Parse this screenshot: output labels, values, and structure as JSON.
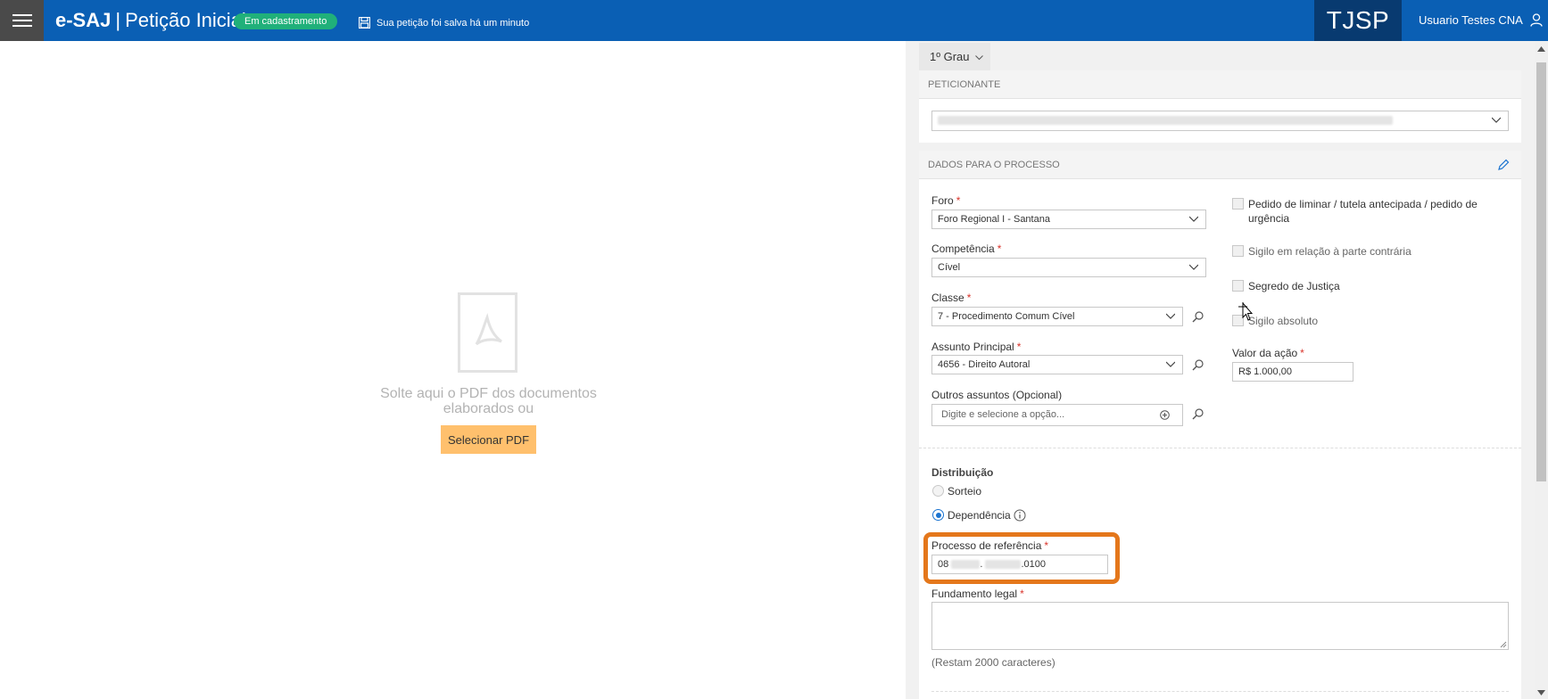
{
  "header": {
    "app_name": "e-SAJ",
    "separator": "|",
    "page_title": "Petição Inicial",
    "status_badge": "Em cadastramento",
    "save_status": "Sua petição foi salva há um minuto",
    "org": "TJSP",
    "user_name": "Usuario Testes CNA",
    "brand_color": "#0a5fb4"
  },
  "upload": {
    "drop_text": "Solte aqui o PDF dos documentos elaborados ou",
    "select_button": "Selecionar PDF",
    "button_color": "#ffc06d"
  },
  "tabs": {
    "grau": "1º Grau"
  },
  "peticionante": {
    "section_title": "PETICIONANTE"
  },
  "processo": {
    "section_title": "DADOS PARA O PROCESSO",
    "foro": {
      "label": "Foro",
      "value": "Foro Regional I - Santana"
    },
    "competencia": {
      "label": "Competência",
      "value": "Cível"
    },
    "classe": {
      "label": "Classe",
      "value": "7 - Procedimento Comum Cível"
    },
    "assunto": {
      "label": "Assunto Principal",
      "value": "4656 - Direito Autoral"
    },
    "outros": {
      "label": "Outros assuntos (Opcional)",
      "placeholder": "Digite e selecione a opção..."
    },
    "checks": {
      "liminar": "Pedido de liminar / tutela antecipada / pedido de urgência",
      "sigilo_contraria": "Sigilo em relação à parte contrária",
      "segredo": "Segredo de Justiça",
      "sigilo_absoluto": "Sigilo absoluto"
    },
    "valor": {
      "label": "Valor da ação",
      "value": "R$ 1.000,00"
    },
    "distribuicao": {
      "label": "Distribuição",
      "sorteio": "Sorteio",
      "dependencia": "Dependência"
    },
    "processo_ref": {
      "label": "Processo de referência",
      "prefix": "08",
      "dot": ".",
      "suffix": ".0100"
    },
    "fundamento": {
      "label": "Fundamento legal",
      "remaining": "(Restam 2000 caracteres)"
    },
    "required_mark": "*"
  }
}
